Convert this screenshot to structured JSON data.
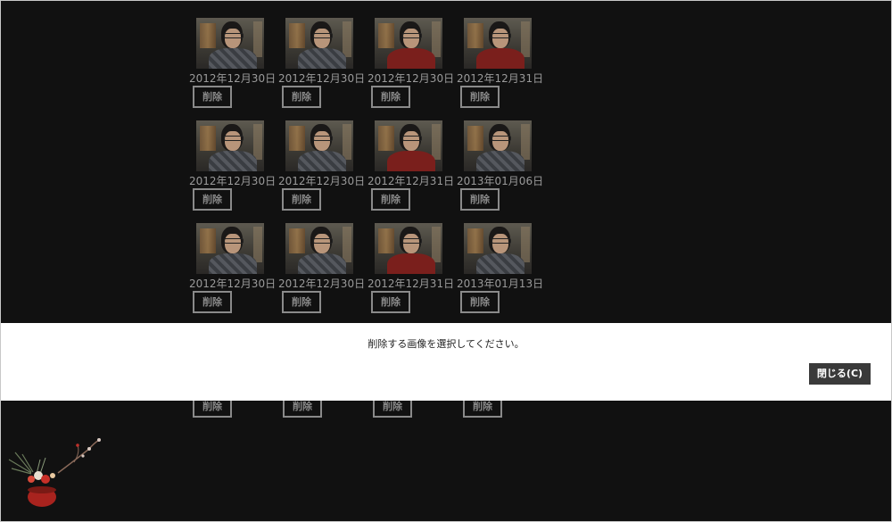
{
  "photos": [
    [
      {
        "date": "2012年12月30日",
        "delete_label": "削除",
        "shirt": "plaid"
      },
      {
        "date": "2012年12月30日",
        "delete_label": "削除",
        "shirt": "plaid"
      },
      {
        "date": "2012年12月30日",
        "delete_label": "削除",
        "shirt": "red"
      },
      {
        "date": "2012年12月31日",
        "delete_label": "削除",
        "shirt": "red"
      }
    ],
    [
      {
        "date": "2012年12月30日",
        "delete_label": "削除",
        "shirt": "plaid"
      },
      {
        "date": "2012年12月30日",
        "delete_label": "削除",
        "shirt": "plaid"
      },
      {
        "date": "2012年12月31日",
        "delete_label": "削除",
        "shirt": "red"
      },
      {
        "date": "2013年01月06日",
        "delete_label": "削除",
        "shirt": "plaid"
      }
    ],
    [
      {
        "date": "2012年12月30日",
        "delete_label": "削除",
        "shirt": "plaid"
      },
      {
        "date": "2012年12月30日",
        "delete_label": "削除",
        "shirt": "plaid"
      },
      {
        "date": "2012年12月31日",
        "delete_label": "削除",
        "shirt": "red"
      },
      {
        "date": "2013年01月13日",
        "delete_label": "削除",
        "shirt": "plaid"
      }
    ]
  ],
  "partial_row_labels": [
    "削除",
    "削除",
    "削除",
    "削除"
  ],
  "dialog": {
    "message": "削除する画像を選択してください。",
    "close_label": "閉じる(C)"
  },
  "colors": {
    "background": "#111111",
    "dialog_bg": "#ffffff",
    "close_button_bg": "#3a3a3a"
  }
}
